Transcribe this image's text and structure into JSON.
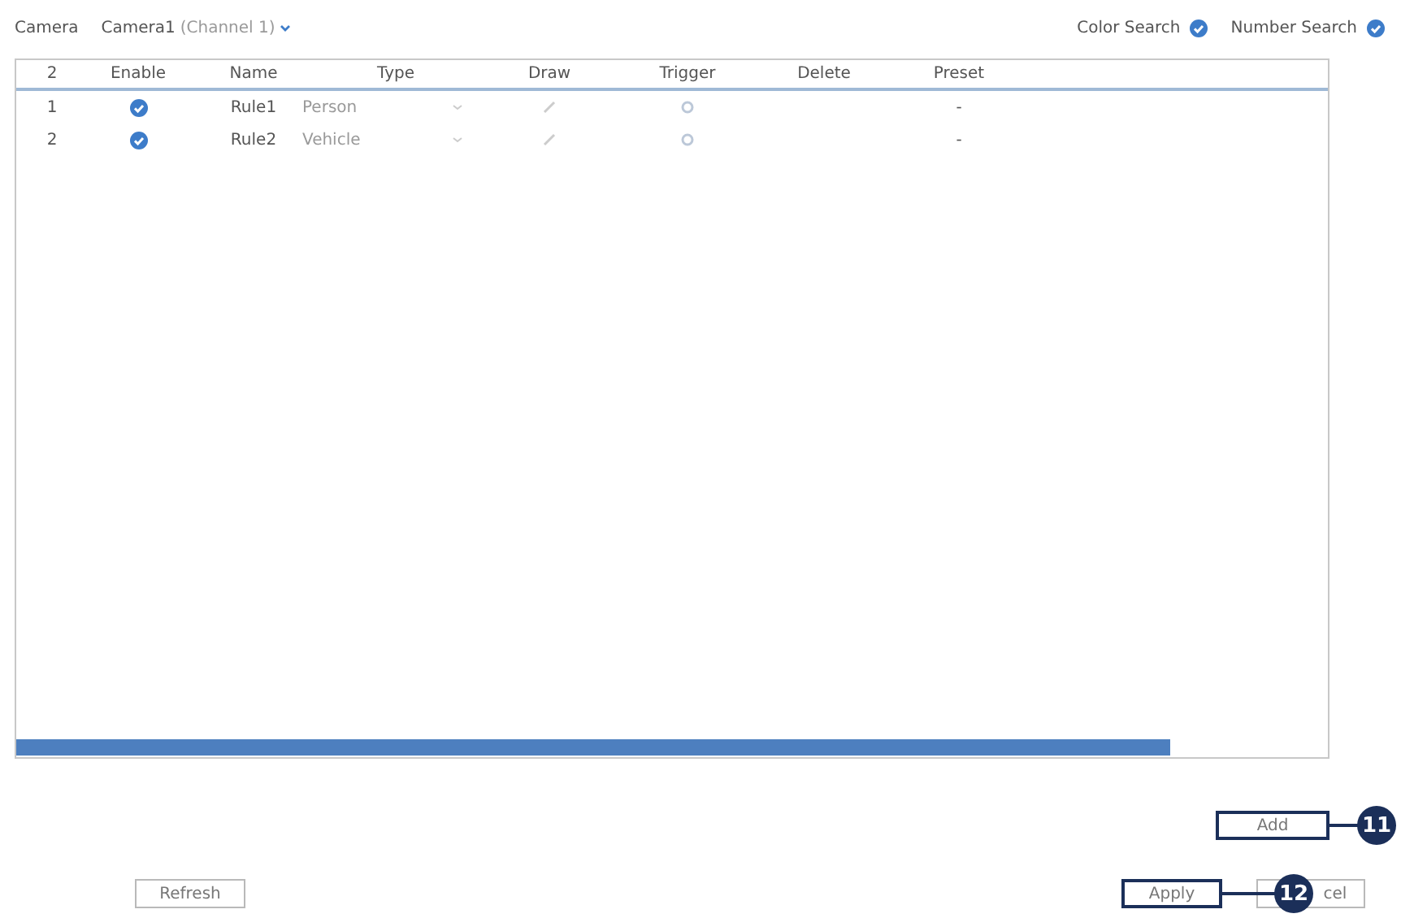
{
  "camera": {
    "label": "Camera",
    "value": "Camera1",
    "channel": "(Channel 1)"
  },
  "search_options": [
    {
      "label": "Color Search",
      "checked": true
    },
    {
      "label": "Number Search",
      "checked": true
    }
  ],
  "table": {
    "columns": [
      "2",
      "Enable",
      "Name",
      "Type",
      "Draw",
      "Trigger",
      "Delete",
      "Preset"
    ],
    "rows": [
      {
        "index": "1",
        "enabled": true,
        "name": "Rule1",
        "type": "Person",
        "preset": "-"
      },
      {
        "index": "2",
        "enabled": true,
        "name": "Rule2",
        "type": "Vehicle",
        "preset": "-"
      }
    ]
  },
  "add_button": {
    "label": "Add",
    "callout": "11"
  },
  "refresh_button": "Refresh",
  "apply_button": {
    "label": "Apply",
    "callout": "12"
  },
  "cancel_button": "cel"
}
